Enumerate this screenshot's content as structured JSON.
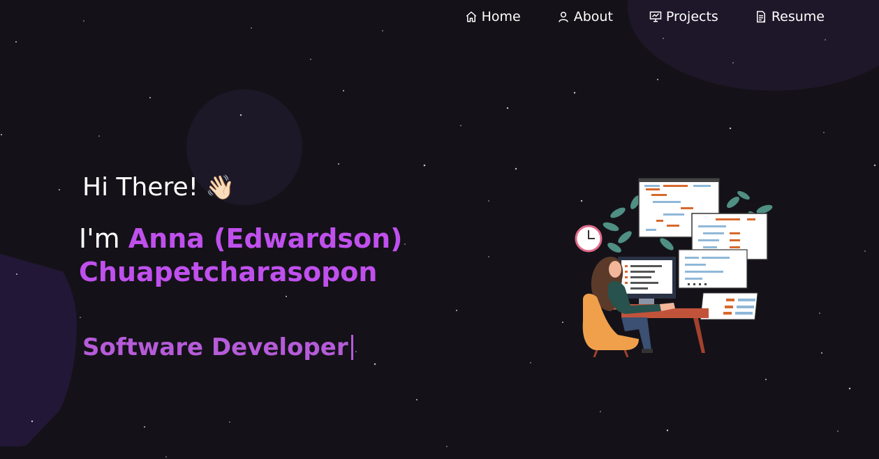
{
  "nav": {
    "items": [
      {
        "label": "Home",
        "icon": "home-icon"
      },
      {
        "label": "About",
        "icon": "user-icon"
      },
      {
        "label": "Projects",
        "icon": "presentation-icon"
      },
      {
        "label": "Resume",
        "icon": "document-icon"
      }
    ]
  },
  "hero": {
    "greeting": "Hi There!",
    "greeting_emoji": "👋🏻",
    "intro_prefix": "I'm ",
    "name_line1": "Anna (Edwardson)",
    "name_line2": "Chuapetcharasopon",
    "role": "Software Developer"
  },
  "colors": {
    "background": "#141218",
    "accent": "#c050ee",
    "role": "#b65bd9",
    "text": "#ffffff"
  },
  "illustration": {
    "icon": "developer-at-computer-illustration"
  }
}
